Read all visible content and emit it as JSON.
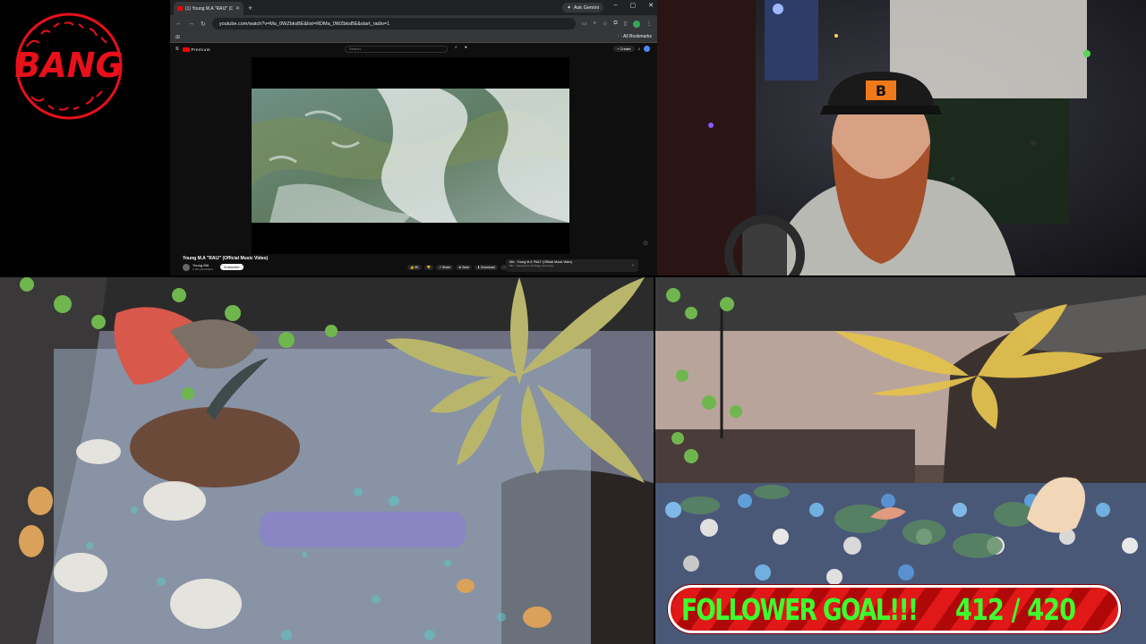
{
  "logo": {
    "text": "BANG"
  },
  "browser": {
    "tab_title": "(1) Young M.A \"RAIJ\" (Offi",
    "tab_close": "✕",
    "new_tab": "+",
    "ask_gemini": "Ask Gemini",
    "url": "youtube.com/watch?v=Ma_0WZbksBE&list=RDMa_0WZbksBE&start_radio=1",
    "all_bookmarks": "All Bookmarks"
  },
  "youtube": {
    "logo_text": "Premium",
    "search_placeholder": "Search",
    "create_label": "+ Create",
    "video_title": "Young M.A \"RAIJ\" (Official Music Video)",
    "channel_name": "Young MA",
    "channel_subs": "1.1M subscribers",
    "subscribe_label": "Subscribe",
    "actions": [
      "👍 8K",
      "👎",
      "↗ Share",
      "⊕ Save",
      "⬇ Download",
      "···"
    ],
    "up_next_title": "Mix - Young M.A \"RAIJ\" (Official Music Video)",
    "up_next_sub": "Mix · Young M.A, 42 Dugg, and more"
  },
  "overlay": {
    "goal_label": "FOLLOWER GOAL!!!",
    "goal_count": "412 / 420",
    "goal_current": 412,
    "goal_target": 420
  },
  "colors": {
    "goal_text": "#3dff2e",
    "goal_bg": "#e01818",
    "logo_red": "#e8101a"
  },
  "icons": [
    "youtube-icon",
    "back-icon",
    "forward-icon",
    "reload-icon",
    "bookmark-star-icon",
    "extensions-icon",
    "profile-icon",
    "menu-icon",
    "bell-icon",
    "mic-icon",
    "search-icon"
  ]
}
